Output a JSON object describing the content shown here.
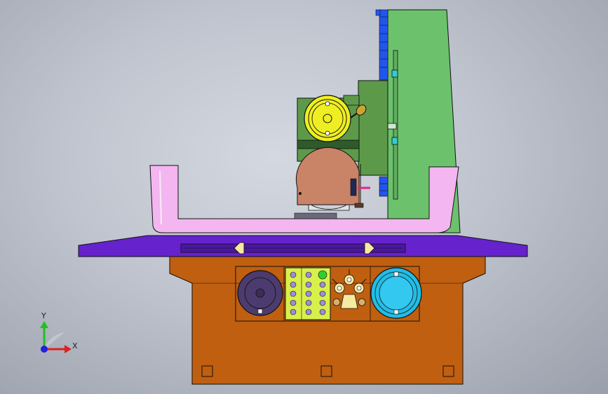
{
  "viewport": {
    "background_top": "#d4d8e0",
    "background_bottom": "#9aa0ab"
  },
  "model": {
    "colors": {
      "base": "#c05f10",
      "table": "#6622cc",
      "guard": "#f3b6f0",
      "column": "#6cc26c",
      "head": "#5c9a4a",
      "handwheel": "#eeee22",
      "wheel_guard": "#c98367",
      "panel": "#d8f04a",
      "knob_left": "#4b3b6e",
      "knob_right": "#22bde6",
      "ribs": "#2255ee"
    }
  },
  "triad": {
    "x_label": "X",
    "y_label": "Y",
    "x_color": "#e02020",
    "y_color": "#20c020",
    "z_color": "#2020e0"
  }
}
